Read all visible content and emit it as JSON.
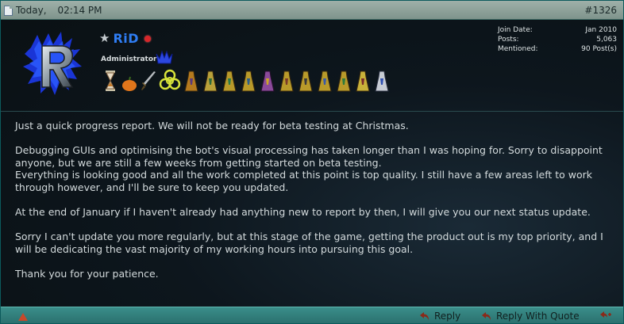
{
  "header": {
    "date": "Today,",
    "time": "02:14 PM",
    "post_number": "#1326"
  },
  "user": {
    "name": "RiD",
    "title": "Administrator",
    "stats": [
      {
        "label": "Join Date:",
        "value": "Jan 2010"
      },
      {
        "label": "Posts:",
        "value": "5,063"
      },
      {
        "label": "Mentioned:",
        "value": "90 Post(s)"
      }
    ]
  },
  "message": {
    "paragraphs": [
      "Just a quick progress report. We will not be ready for beta testing at Christmas.",
      "Debugging GUIs and optimising the bot's visual processing has taken longer than I was hoping for. Sorry to disappoint anyone, but we are still a few weeks from getting started on beta testing.\nEverything is looking good and all the work completed at this point is top quality. I still have a few areas left to work through however, and I'll be sure to keep you updated.",
      "At the end of January if I haven't already had anything new to report by then, I will give you our next status update.",
      "Sorry I can't update you more regularly, but at this stage of the game, getting the product out is my top priority, and I will be dedicating the vast majority of my working hours into pursuing this goal.",
      "Thank you for your patience."
    ]
  },
  "footer": {
    "reply_label": "Reply",
    "quote_label": "Reply With Quote"
  },
  "colors": {
    "username": "#2f7df3",
    "header_bar": "#8fa39b",
    "footer_bar": "#2f7f7c"
  }
}
